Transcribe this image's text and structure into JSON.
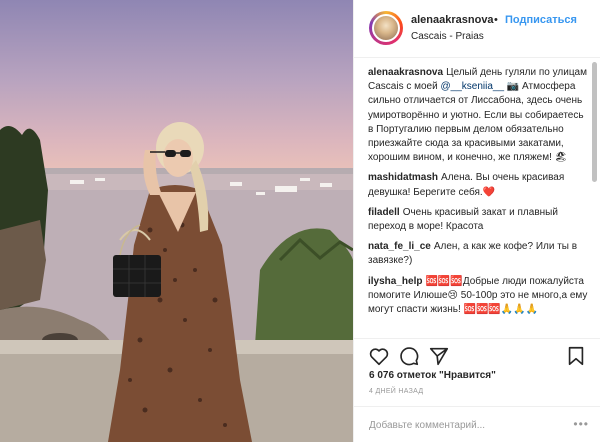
{
  "post": {
    "username": "alenaakrasnova",
    "separator": "•",
    "follow_label": "Подписаться",
    "location": "Cascais - Praias"
  },
  "comments": [
    {
      "user": "alenaakrasnova",
      "pre": "Целый день гуляли по улицам Cascais с моей ",
      "mention": "@__kseniia__",
      "post": " 📷 Атмосфера сильно отличается от Лиссабона, здесь очень умиротворённо и уютно. Если вы собираетесь в Португалию первым делом обязательно приезжайте сюда за красивыми закатами, хорошим вином, и конечно, же пляжем! 🏖"
    },
    {
      "user": "mashidatmash",
      "text": "Алена. Вы очень красивая девушка! Берегите себя.❤️"
    },
    {
      "user": "filadell",
      "text": "Очень красивый закат и плавный переход в море! Красота"
    },
    {
      "user": "nata_fe_li_ce",
      "text": "Ален, а как же кофе? Или ты в завязке?)"
    },
    {
      "user": "ilysha_help",
      "text": "🆘🆘🆘Добрые люди пожалуйста помогите Илюше😢 50-100р это не много,а ему могут спасти жизнь! 🆘🆘🆘🙏🙏🙏"
    }
  ],
  "likes": "6 076 отметок \"Нравится\"",
  "date": "4 ДНЕЙ НАЗАД",
  "add_comment_placeholder": "Добавьте комментарий...",
  "more_label": "•••",
  "icons": [
    "heart-icon",
    "comment-icon",
    "share-icon",
    "bookmark-icon",
    "sunglasses-emoji",
    "beach-emoji"
  ]
}
